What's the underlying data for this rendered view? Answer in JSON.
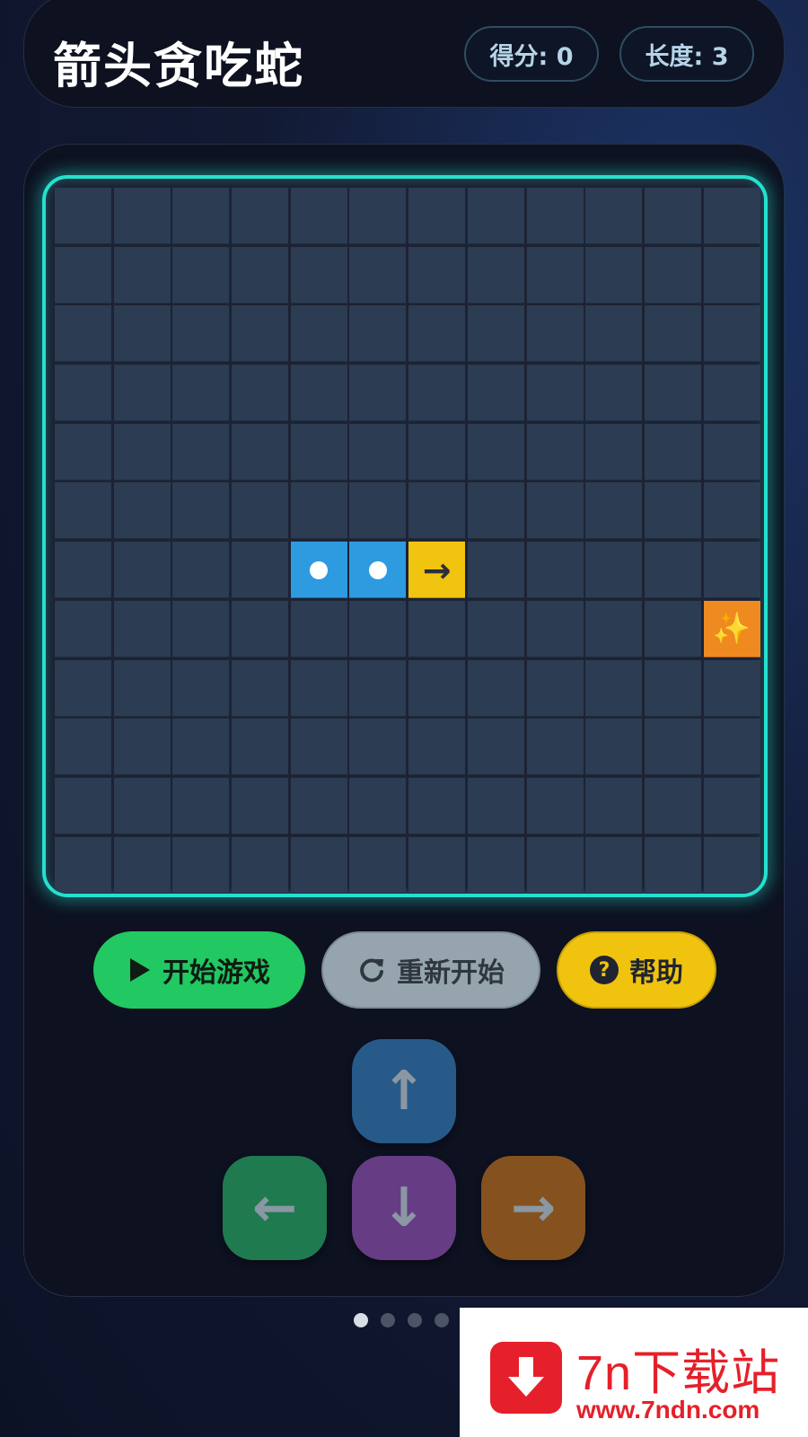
{
  "header": {
    "title": "箭头贪吃蛇",
    "score_label": "得分: 0",
    "length_label": "长度: 3"
  },
  "board": {
    "rows": 12,
    "cols": 12,
    "snake": [
      {
        "row": 6,
        "col": 4,
        "part": "body"
      },
      {
        "row": 6,
        "col": 5,
        "part": "body"
      },
      {
        "row": 6,
        "col": 6,
        "part": "head",
        "glyph": "→"
      }
    ],
    "food": {
      "row": 7,
      "col": 11,
      "glyph": "✨"
    },
    "colors": {
      "border": "#25e0cf",
      "cell": "#2c3c52",
      "snake_body": "#2e9be0",
      "snake_head": "#f1c40f",
      "food": "#ef8a21"
    }
  },
  "controls": {
    "start_label": "开始游戏",
    "start_icon": "play-icon",
    "restart_label": "重新开始",
    "restart_icon": "refresh-icon",
    "help_label": "帮助",
    "help_icon": "question-icon"
  },
  "dpad": {
    "up": "↑",
    "left": "←",
    "down": "↓",
    "right": "→"
  },
  "pagination": {
    "count": 4,
    "active": 0
  },
  "watermark": {
    "name": "7n下载站",
    "url": "www.7ndn.com"
  }
}
